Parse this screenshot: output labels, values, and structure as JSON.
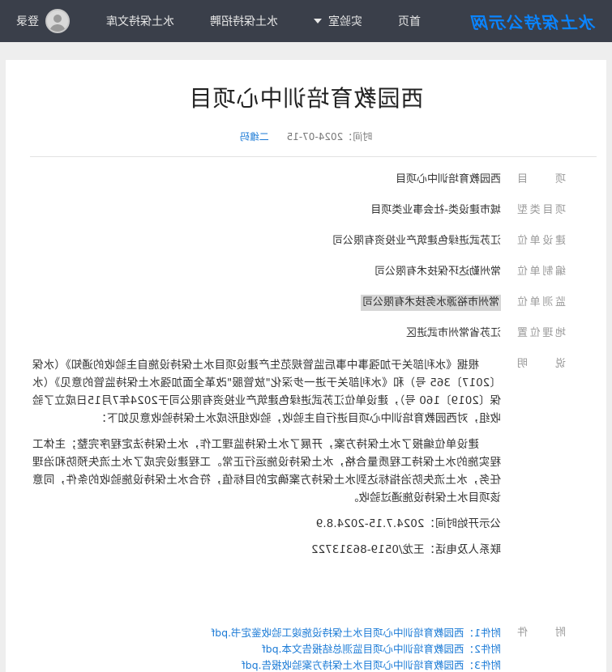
{
  "header": {
    "logo": "水土保持公示网",
    "nav": [
      {
        "label": "首页",
        "active": true
      },
      {
        "label": "实验室",
        "dropdown": true
      },
      {
        "label": "水土保持招聘"
      },
      {
        "label": "水土保持文库"
      }
    ],
    "login_label": "登录"
  },
  "article": {
    "title": "西园教育培训中心项目",
    "time_label": "时间：",
    "time": "2024-07-15",
    "qr_label": "二维码"
  },
  "info": [
    {
      "label": "项　　目",
      "value": "西园教育培训中心项目"
    },
    {
      "label": "项目类型",
      "value": "城市建设类-社会事业类项目"
    },
    {
      "label": "建设单位",
      "value": "江苏武进绿色建筑产业投资有限公司"
    },
    {
      "label": "编制单位",
      "value": "常州勤达环保技术有限公司"
    },
    {
      "label": "监测单位",
      "value": "常州市裕源水务技术有限公司",
      "highlight": true
    },
    {
      "label": "地理位置",
      "value": "江苏省常州市武进区"
    }
  ],
  "description": {
    "label": "说　　明",
    "paragraphs": [
      "根据《水利部关于加强事中事后监管规范生产建设项目水土保持设施自主验收的通知》（水保〔2017〕365 号）和《水利部关于进一步深化\"放管服\"改革全面加强水土保持监管的意见》（水保〔2019〕160 号），建设单位江苏武进绿色建筑产业投资有限公司于2024年7月15日成立了验收组，对西园教育培训中心项目进行自主验收，验收组形成水土保持验收意见如下：",
      "建设单位编报了水土保持方案，开展了水土保持监理工作，水土保持法定程序完整；主体工程实施的水土保持工程质量合格，水土保持设施运行正常。工程建设完成了水土流失预防和治理任务，水土流失防治指标达到水土保持方案确定的目标值，符合水土保持设施验收的条件，同意该项目水土保持设施通过验收。"
    ],
    "publicity": "公示开始时间：2024.7.15-2024.8.9",
    "contact": "联系人及电话：王龙/0519-86313722"
  },
  "attachments": {
    "label": "附　　件",
    "items": [
      "附件1：西园教育培训中心项目水土保持设施竣工验收鉴定书.pdf",
      "附件2：西园教育培训中心项目监测总结报告文本.pdf",
      "附件3：西园教育培训中心项目水土保持方案验收报告.pdf"
    ]
  },
  "colors": {
    "topbar": "#3a3f4a",
    "logo": "#0a84ff",
    "link": "#1a7ad6",
    "highlight": "#d6d6d6"
  }
}
